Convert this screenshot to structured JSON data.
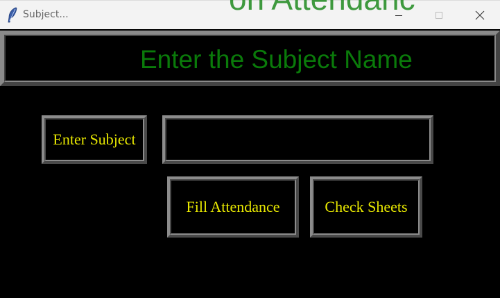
{
  "window": {
    "title": "Subject...",
    "background_peek_text": "on Attendanc"
  },
  "header": {
    "title": "Enter the Subject Name",
    "text_color": "#0a7a0a"
  },
  "form": {
    "subject_label": "Enter Subject",
    "subject_value": "",
    "subject_placeholder": ""
  },
  "buttons": {
    "fill_attendance": "Fill Attendance",
    "check_sheets": "Check Sheets"
  },
  "colors": {
    "background": "#000000",
    "label_text": "#e8e800",
    "titlebar": "#f3f3f3"
  },
  "icons": {
    "app": "feather-icon",
    "minimize": "minimize-icon",
    "maximize": "maximize-icon",
    "close": "close-icon"
  }
}
